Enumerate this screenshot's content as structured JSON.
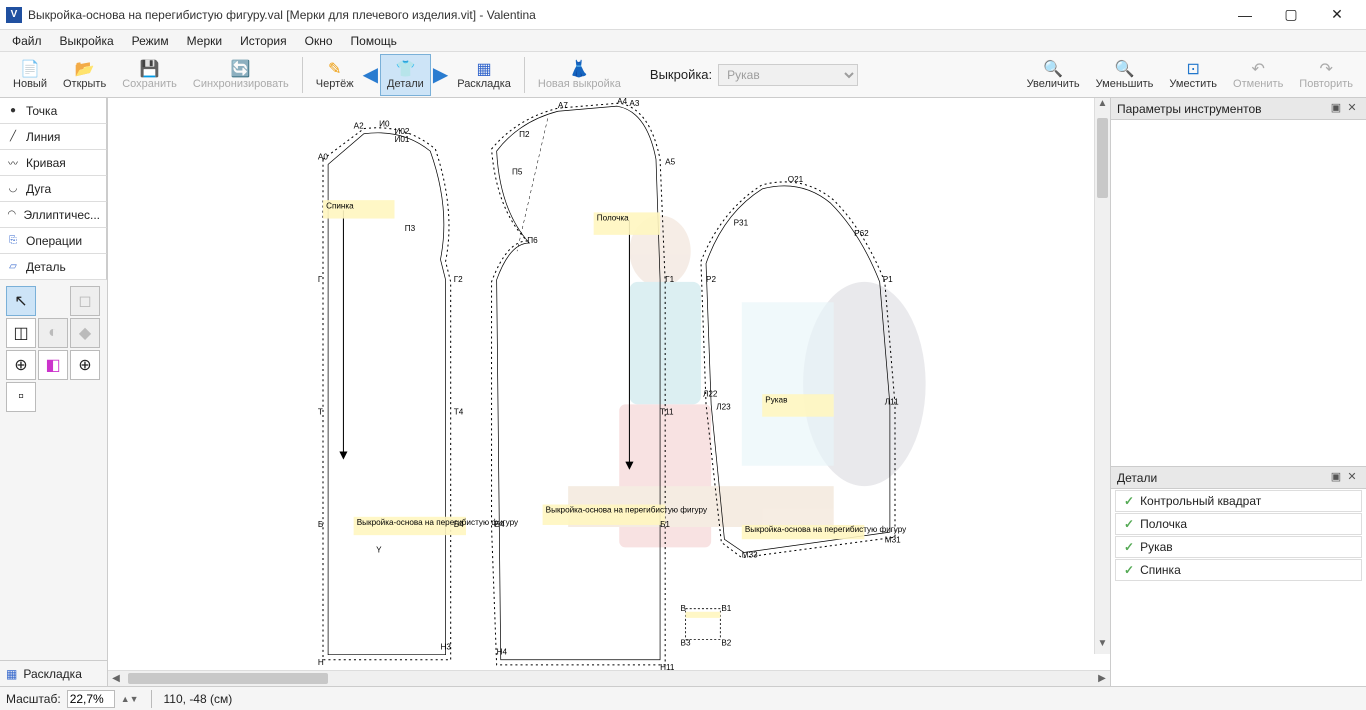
{
  "title": "Выкройка-основа на перегибистую фигуру.val [Мерки для плечевого изделия.vit] - Valentina",
  "menu": [
    "Файл",
    "Выкройка",
    "Режим",
    "Мерки",
    "История",
    "Окно",
    "Помощь"
  ],
  "toolbar": {
    "new": "Новый",
    "open": "Открыть",
    "save": "Сохранить",
    "sync": "Синхронизировать",
    "draft": "Чертёж",
    "details": "Детали",
    "layout": "Раскладка",
    "new_pattern": "Новая выкройка",
    "pattern_label": "Выкройка:",
    "pattern_value": "Рукав",
    "zoom_in": "Увеличить",
    "zoom_out": "Уменьшить",
    "zoom_fit": "Уместить",
    "undo": "Отменить",
    "redo": "Повторить"
  },
  "left_tabs": {
    "point": "Точка",
    "line": "Линия",
    "curve": "Кривая",
    "arc": "Дуга",
    "elliptical": "Эллиптичес...",
    "operations": "Операции",
    "detail": "Деталь"
  },
  "left_bottom": "Раскладка",
  "panels": {
    "params": "Параметры инструментов",
    "details": "Детали"
  },
  "details_list": [
    "Контрольный квадрат",
    "Полочка",
    "Рукав",
    "Спинка"
  ],
  "status": {
    "scale_label": "Масштаб:",
    "scale_value": "22,7%",
    "coords": "110, -48 (см)"
  },
  "pattern_points": {
    "back": [
      "А2",
      "И0",
      "И02",
      "И01",
      "А0",
      "П3",
      "Г",
      "Г2",
      "Т",
      "Т4",
      "Б",
      "Б4",
      "Н",
      "Н3",
      "Y"
    ],
    "front": [
      "А7",
      "А4",
      "А3",
      "П2",
      "П5",
      "П6",
      "А5",
      "Г1",
      "Т11",
      "Б1",
      "Б4",
      "Н4",
      "Н11"
    ],
    "sleeve": [
      "О21",
      "Р31",
      "Р62",
      "Р2",
      "Р1",
      "Л22",
      "Л23",
      "Л11",
      "М31",
      "М33"
    ],
    "square": [
      "В",
      "В1",
      "В3",
      "В2"
    ]
  },
  "annotations": {
    "back": "Спинка",
    "front": "Полочка",
    "sleeve": "Рукав",
    "caption": "Выкройка-основа на перегибистую фигуру"
  }
}
